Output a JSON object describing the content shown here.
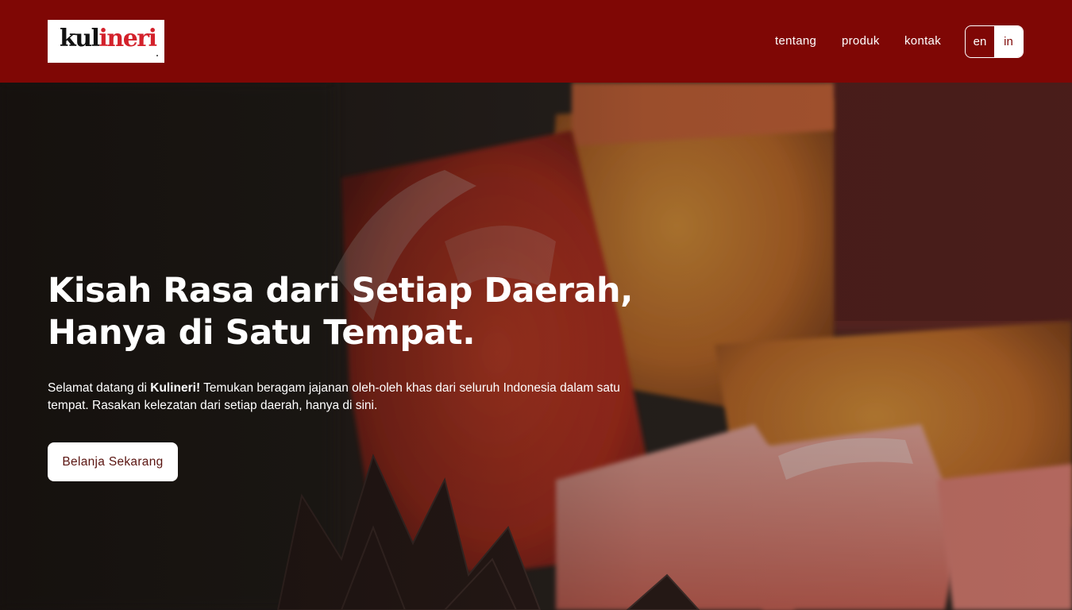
{
  "header": {
    "logo": {
      "part1": "kul",
      "part2": "ineri"
    },
    "nav": [
      {
        "label": "tentang"
      },
      {
        "label": "produk"
      },
      {
        "label": "kontak"
      }
    ],
    "languages": {
      "en": "en",
      "in": "in",
      "active": "in"
    }
  },
  "hero": {
    "title_line1": "Kisah Rasa dari Setiap Daerah,",
    "title_line2": "Hanya di Satu Tempat.",
    "desc_before": "Selamat datang di ",
    "desc_brand": "Kulineri!",
    "desc_after": " Temukan beragam jajanan oleh-oleh khas dari seluruh Indonesia dalam satu tempat. Rasakan kelezatan dari setiap daerah, hanya di sini.",
    "cta_label": "Belanja Sekarang"
  },
  "colors": {
    "brand_red": "#7f0705",
    "accent_red": "#d3212b",
    "white": "#ffffff"
  }
}
